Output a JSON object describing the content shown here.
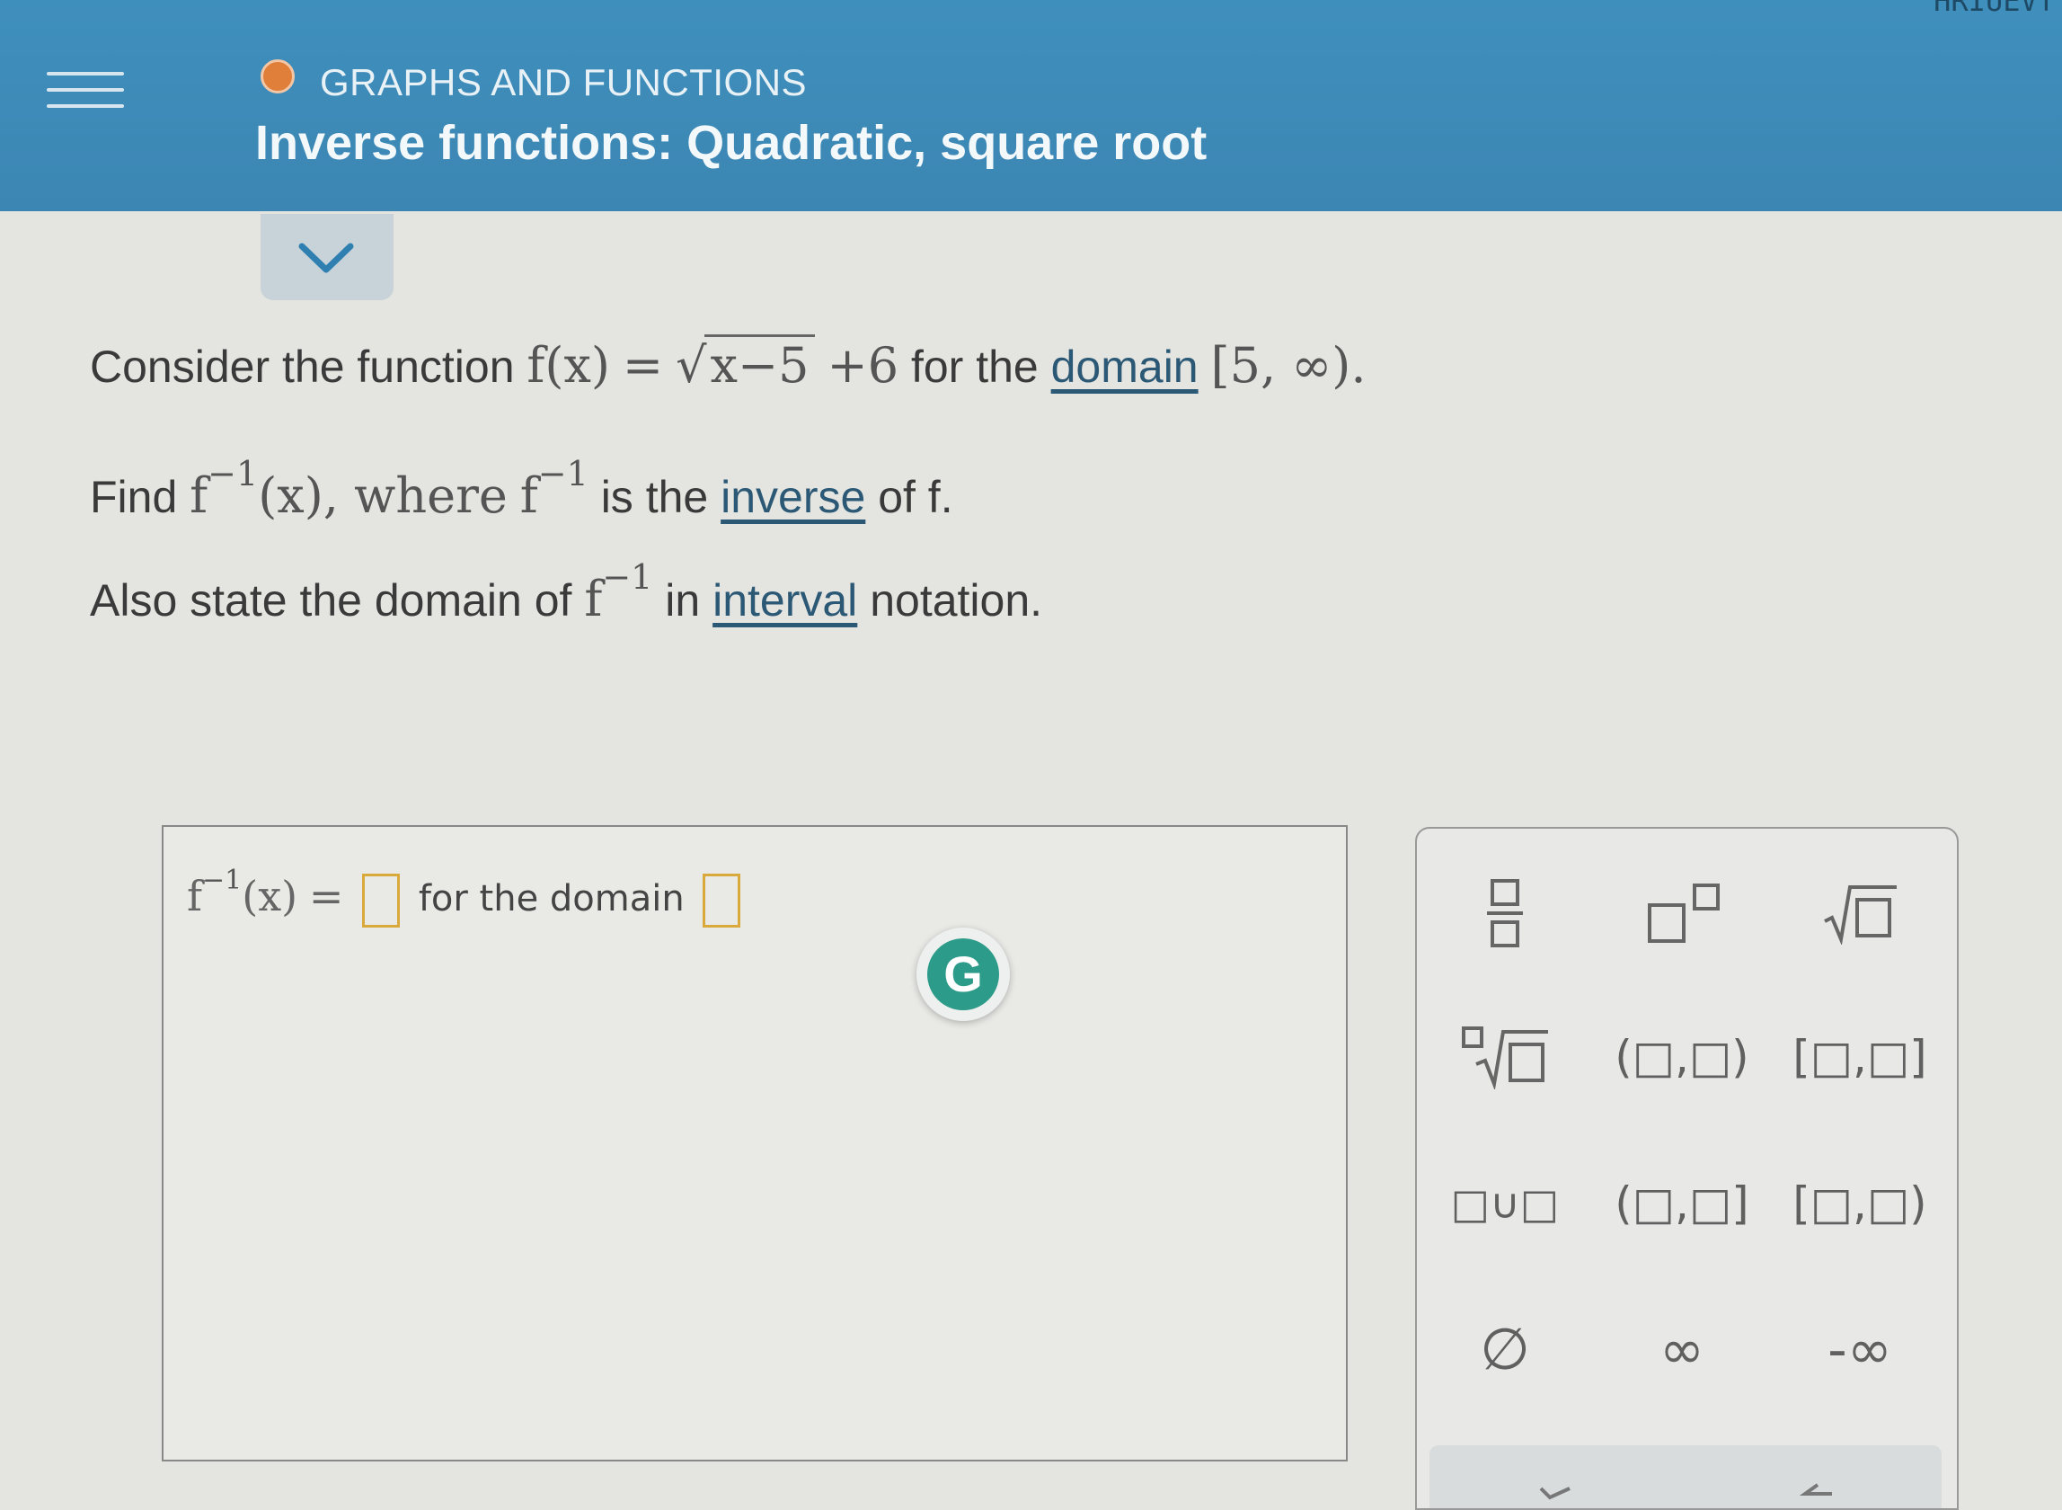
{
  "header": {
    "topic": "GRAPHS AND FUNCTIONS",
    "title": "Inverse functions: Quadratic, square root",
    "corner_text": "HRIUEVT"
  },
  "problem": {
    "consider_prefix": "Consider the function",
    "function_lhs": "f(x)",
    "function_eq": "=",
    "radicand": "x−5",
    "function_tail": "+6",
    "for_the": "for the",
    "domain_link": "domain",
    "domain_value": "[5, ∞).",
    "find_prefix": "Find",
    "f_symbol": "f",
    "inv_exp": "−1",
    "of_x": "(x), where",
    "is_the": "is the",
    "inverse_link": "inverse",
    "of_f": "of f.",
    "also_prefix": "Also state the domain of",
    "in_word": "in",
    "interval_link": "interval",
    "notation_suffix": "notation."
  },
  "answer": {
    "lhs_f": "f",
    "lhs_exp": "−1",
    "lhs_arg": "(x)",
    "equals": "=",
    "for_domain": "for the domain"
  },
  "grammarly": {
    "letter": "G"
  },
  "keypad": {
    "keys": [
      {
        "name": "fraction",
        "label": ""
      },
      {
        "name": "exponent",
        "label": ""
      },
      {
        "name": "sqrt",
        "label": ""
      },
      {
        "name": "nth-root",
        "label": ""
      },
      {
        "name": "open-interval",
        "label": "(□,□)"
      },
      {
        "name": "closed-interval",
        "label": "[□,□]"
      },
      {
        "name": "union",
        "label": "□∪□"
      },
      {
        "name": "left-open-interval",
        "label": "(□,□]"
      },
      {
        "name": "right-open-interval",
        "label": "[□,□)"
      },
      {
        "name": "empty-set",
        "label": "∅"
      },
      {
        "name": "infinity",
        "label": "∞"
      },
      {
        "name": "neg-infinity",
        "label": "-∞"
      }
    ]
  }
}
